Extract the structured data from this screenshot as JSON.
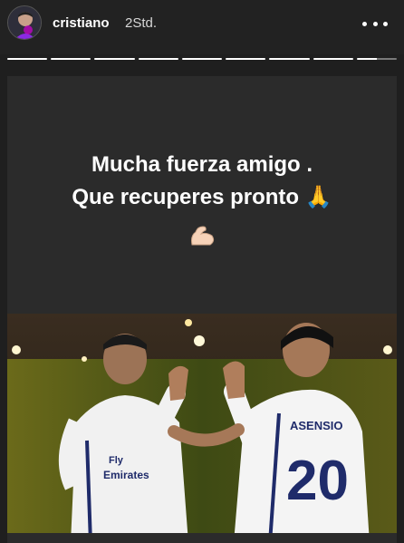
{
  "header": {
    "username": "cristiano",
    "time": "2Std.",
    "avatar_icon": "profile-avatar",
    "more_icon": "more-dots-icon"
  },
  "progress": {
    "segments_total": 9,
    "segments_complete": 8,
    "current_segment_progress": 0.5
  },
  "story": {
    "line1": "Mucha fuerza amigo .",
    "line2": "Que recuperes pronto 🙏",
    "emoji_icon": "flexed-biceps-icon",
    "photo_jersey_name": "ASENSIO",
    "photo_jersey_number": "20",
    "photo_sponsor": "Fly Emirates"
  },
  "colors": {
    "background": "#1f1f1f",
    "story_bg": "#2b2b2b",
    "text": "#ffffff"
  }
}
